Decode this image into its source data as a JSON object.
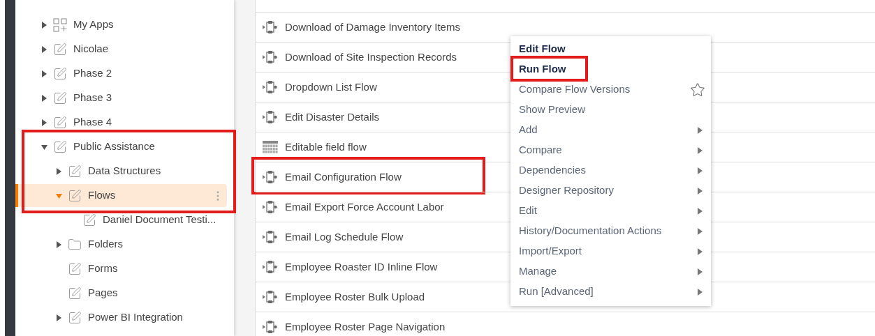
{
  "sidebar": {
    "items": [
      {
        "label": "My Apps",
        "kind": "apps",
        "expanded": false,
        "has_children": true,
        "selected": false,
        "highlighted": false
      },
      {
        "label": "Nicolae",
        "kind": "edit",
        "expanded": false,
        "has_children": true,
        "selected": false,
        "highlighted": false
      },
      {
        "label": "Phase 2",
        "kind": "edit",
        "expanded": false,
        "has_children": true,
        "selected": false,
        "highlighted": false
      },
      {
        "label": "Phase 3",
        "kind": "edit",
        "expanded": false,
        "has_children": true,
        "selected": false,
        "highlighted": false
      },
      {
        "label": "Phase 4",
        "kind": "edit",
        "expanded": false,
        "has_children": true,
        "selected": false,
        "highlighted": false
      },
      {
        "label": "Public Assistance",
        "kind": "edit",
        "expanded": true,
        "has_children": true,
        "selected": false,
        "highlighted": true,
        "children": [
          {
            "label": "Data Structures",
            "kind": "edit",
            "expanded": false,
            "has_children": true,
            "selected": false,
            "highlighted": false
          },
          {
            "label": "Flows",
            "kind": "edit",
            "expanded": true,
            "has_children": true,
            "selected": true,
            "highlighted": false,
            "children": [
              {
                "label": "Daniel Document Testi...",
                "kind": "edit",
                "has_children": false,
                "selected": false,
                "highlighted": false
              }
            ]
          },
          {
            "label": "Folders",
            "kind": "folder",
            "expanded": false,
            "has_children": true,
            "selected": false,
            "highlighted": false
          },
          {
            "label": "Forms",
            "kind": "edit",
            "has_children": false,
            "selected": false,
            "highlighted": false
          },
          {
            "label": "Pages",
            "kind": "edit",
            "has_children": false,
            "selected": false,
            "highlighted": false
          },
          {
            "label": "Power BI Integration",
            "kind": "edit",
            "expanded": false,
            "has_children": true,
            "selected": false,
            "highlighted": false
          }
        ]
      }
    ]
  },
  "flows": [
    {
      "name": "Download of Damage Inventory Items",
      "kind": "flow",
      "highlighted": false
    },
    {
      "name": "Download of Site Inspection Records",
      "kind": "flow",
      "highlighted": false
    },
    {
      "name": "Dropdown List Flow",
      "kind": "flow",
      "highlighted": false
    },
    {
      "name": "Edit Disaster Details",
      "kind": "flow",
      "highlighted": false
    },
    {
      "name": "Editable field flow",
      "kind": "grid",
      "highlighted": false
    },
    {
      "name": "Email Configuration Flow",
      "kind": "flow",
      "highlighted": true
    },
    {
      "name": "Email Export Force Account Labor",
      "kind": "flow",
      "highlighted": false
    },
    {
      "name": "Email Log Schedule Flow",
      "kind": "flow",
      "highlighted": false
    },
    {
      "name": "Employee Roaster ID Inline Flow",
      "kind": "flow",
      "highlighted": false
    },
    {
      "name": "Employee Roster Bulk Upload",
      "kind": "flow",
      "highlighted": false
    },
    {
      "name": "Employee Roster Page Navigation",
      "kind": "flow",
      "highlighted": false
    }
  ],
  "context_menu": {
    "items": [
      {
        "label": "Edit Flow",
        "kind": "primary",
        "highlighted": false
      },
      {
        "label": "Run Flow",
        "kind": "primary",
        "highlighted": true
      },
      {
        "label": "Compare Flow Versions",
        "kind": "favorite",
        "highlighted": false
      },
      {
        "label": "Show Preview",
        "kind": "plain",
        "highlighted": false
      },
      {
        "label": "Add",
        "kind": "submenu",
        "highlighted": false
      },
      {
        "label": "Compare",
        "kind": "submenu",
        "highlighted": false
      },
      {
        "label": "Dependencies",
        "kind": "submenu",
        "highlighted": false
      },
      {
        "label": "Designer Repository",
        "kind": "submenu",
        "highlighted": false
      },
      {
        "label": "Edit",
        "kind": "submenu",
        "highlighted": false
      },
      {
        "label": "History/Documentation Actions",
        "kind": "submenu",
        "highlighted": false
      },
      {
        "label": "Import/Export",
        "kind": "submenu",
        "highlighted": false
      },
      {
        "label": "Manage",
        "kind": "submenu",
        "highlighted": false
      },
      {
        "label": "Run [Advanced]",
        "kind": "submenu",
        "highlighted": false
      }
    ]
  }
}
